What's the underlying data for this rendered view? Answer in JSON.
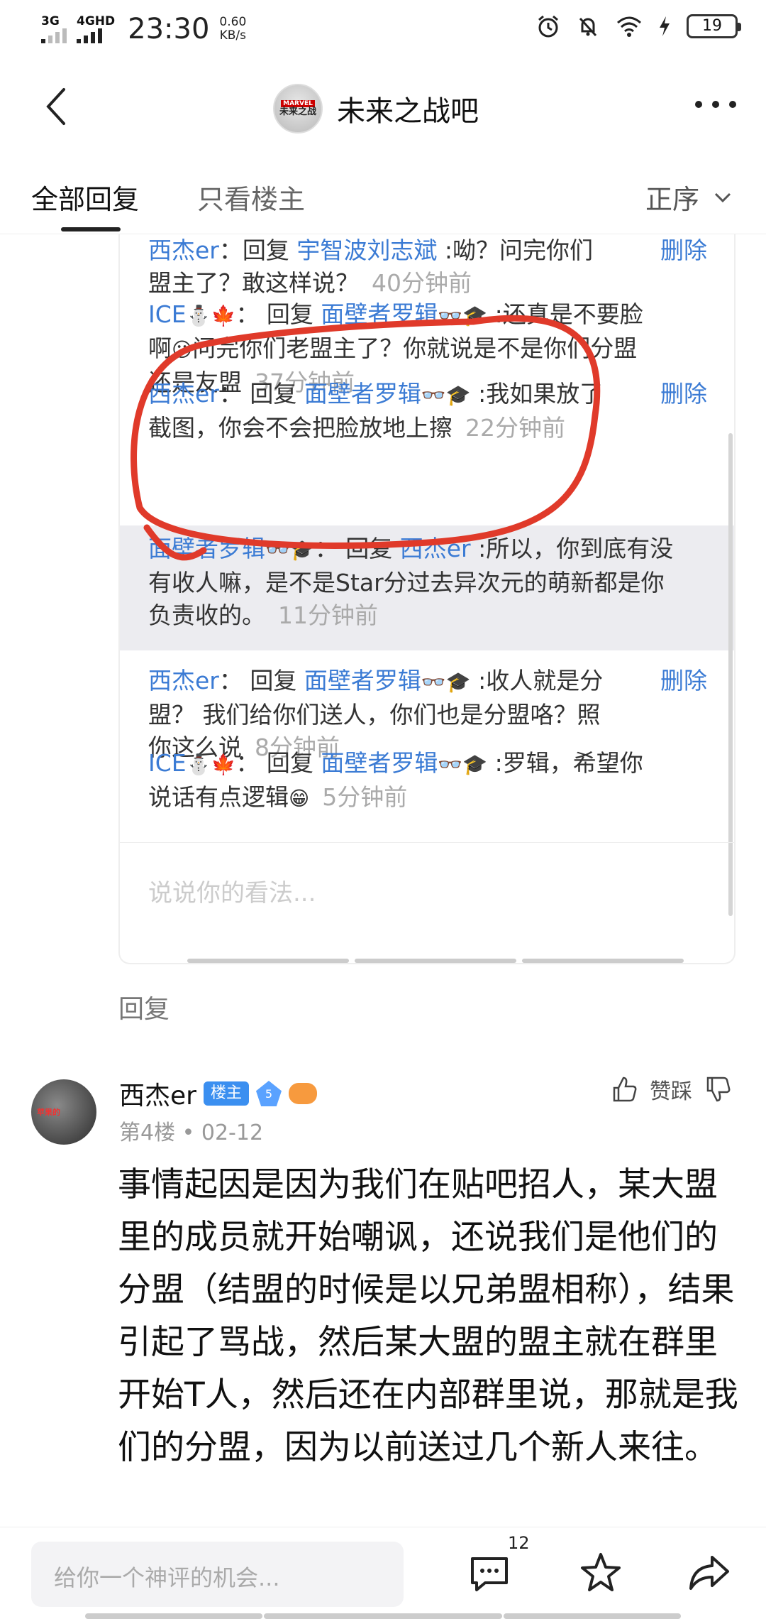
{
  "status_bar": {
    "network1": "3G",
    "network2": "4GHD",
    "time": "23:30",
    "speed_value": "0.60",
    "speed_unit": "KB/s",
    "battery": "19"
  },
  "header": {
    "forum_name": "未来之战吧",
    "logo_label_top": "MARVEL",
    "logo_label": "未来之战"
  },
  "tabs": {
    "all_replies": "全部回复",
    "op_only": "只看楼主",
    "sort": "正序"
  },
  "screenshot": {
    "replies": [
      {
        "user": "西杰er",
        "reply_word": "回复",
        "target": "宇智波刘志斌",
        "text": ":呦？问完你们",
        "line2": "盟主了？敢这样说？",
        "time": "40分钟前",
        "delete": "删除"
      },
      {
        "user": "ICE",
        "reply_word": "回复",
        "target": "面壁者罗辑",
        "text": ":还真是不要脸",
        "line2": "啊",
        "line2b": "问完你们老盟主了？你就说是不是你们分盟",
        "line3": "还是友盟",
        "time": "37分钟前"
      },
      {
        "user": "西杰er",
        "reply_word": "回复",
        "target": "面壁者罗辑",
        "text": ":我如果放了",
        "line2": "截图，你会不会把脸放地上擦",
        "time": "22分钟前",
        "delete": "删除"
      },
      {
        "user": "面壁者罗辑",
        "reply_word": "回复",
        "target": "西杰er",
        "text": ":所以，你到底有没",
        "line2": "有收人嘛，是不是Star分过去异次元的萌新都是你",
        "line3": "负责收的。",
        "time": "11分钟前"
      },
      {
        "user": "西杰er",
        "reply_word": "回复",
        "target": "面壁者罗辑",
        "text": ":收人就是分",
        "line2": "盟？ 我们给你们送人，你们也是分盟咯？照",
        "line3": "你这么说",
        "time": "8分钟前",
        "delete": "删除"
      },
      {
        "user": "ICE",
        "reply_word": "回复",
        "target": "面壁者罗辑",
        "text": ":罗辑，希望你",
        "line2": "说话有点逻辑",
        "time": "5分钟前"
      }
    ],
    "input_placeholder": "说说你的看法..."
  },
  "reply_link": "回复",
  "post": {
    "author": "西杰er",
    "op_badge": "楼主",
    "level": "5",
    "floor": "第4楼",
    "date": "02-12",
    "like_label": "赞踩",
    "body": "事情起因是因为我们在贴吧招人，某大盟里的成员就开始嘲讽，还说我们是他们的分盟（结盟的时候是以兄弟盟相称），结果引起了骂战，然后某大盟的盟主就在群里开始T人，然后还在内部群里说，那就是我们的分盟，因为以前送过几个新人来往。",
    "avatar_text": "苹果的"
  },
  "bottom_bar": {
    "placeholder": "给你一个神评的机会...",
    "comment_count": "12"
  },
  "colors": {
    "link_blue": "#3b7bd4",
    "red_mark": "#e03a2a",
    "badge_blue": "#3b8ff0"
  }
}
